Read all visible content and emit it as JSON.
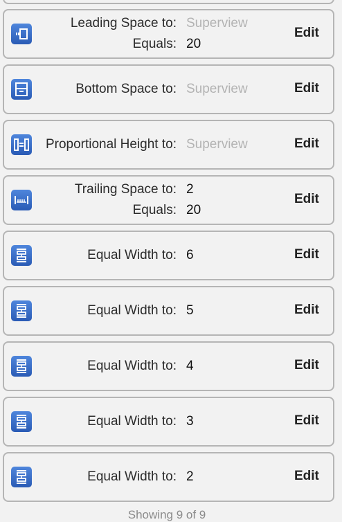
{
  "constraints": [
    {
      "icon": "leading-space-icon",
      "rows": [
        {
          "label": "Leading Space to:",
          "value": "Superview",
          "muted": true
        },
        {
          "label": "Equals:",
          "value": "20"
        }
      ],
      "edit": "Edit"
    },
    {
      "icon": "bottom-space-icon",
      "rows": [
        {
          "label": "Bottom Space to:",
          "value": "Superview",
          "muted": true
        }
      ],
      "edit": "Edit"
    },
    {
      "icon": "proportional-height-icon",
      "rows": [
        {
          "label": "Proportional Height to:",
          "value": "Superview",
          "muted": true
        }
      ],
      "edit": "Edit"
    },
    {
      "icon": "trailing-space-icon",
      "rows": [
        {
          "label": "Trailing Space to:",
          "value": "2"
        },
        {
          "label": "Equals:",
          "value": "20"
        }
      ],
      "edit": "Edit"
    },
    {
      "icon": "equal-width-icon",
      "rows": [
        {
          "label": "Equal Width to:",
          "value": "6"
        }
      ],
      "edit": "Edit"
    },
    {
      "icon": "equal-width-icon",
      "rows": [
        {
          "label": "Equal Width to:",
          "value": "5"
        }
      ],
      "edit": "Edit"
    },
    {
      "icon": "equal-width-icon",
      "rows": [
        {
          "label": "Equal Width to:",
          "value": "4"
        }
      ],
      "edit": "Edit"
    },
    {
      "icon": "equal-width-icon",
      "rows": [
        {
          "label": "Equal Width to:",
          "value": "3"
        }
      ],
      "edit": "Edit"
    },
    {
      "icon": "equal-width-icon",
      "rows": [
        {
          "label": "Equal Width to:",
          "value": "2"
        }
      ],
      "edit": "Edit"
    }
  ],
  "footer": "Showing 9 of 9",
  "colors": {
    "icon": "#3a6fc8",
    "muted": "#b3b3b3"
  }
}
